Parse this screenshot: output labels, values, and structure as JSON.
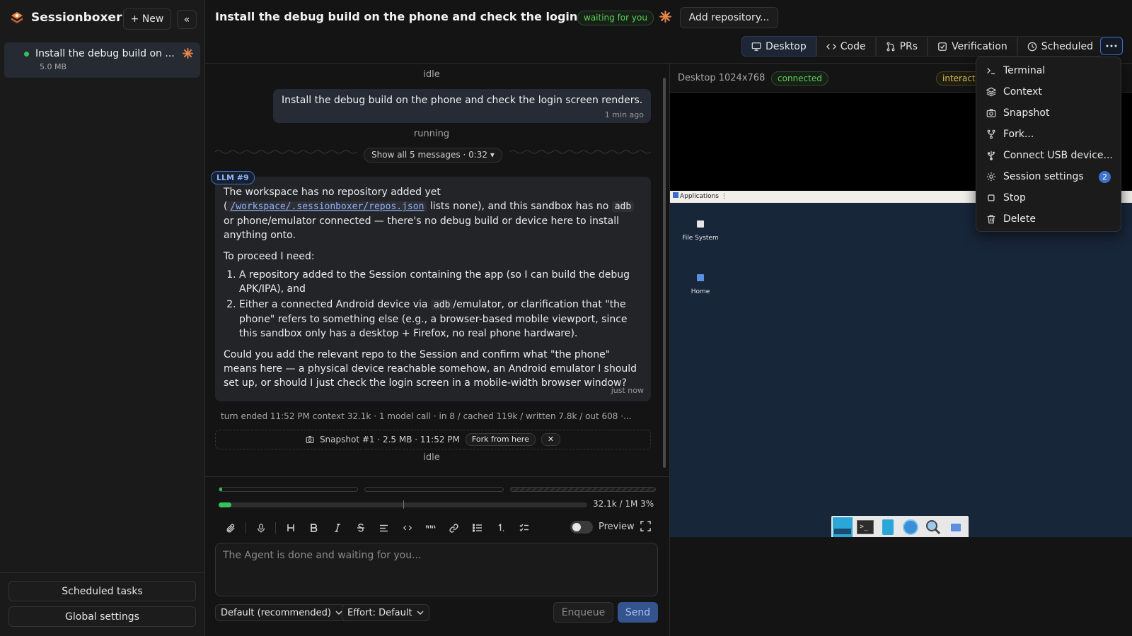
{
  "app": {
    "name": "Sessionboxer"
  },
  "sidebar": {
    "new_label": "+ New",
    "collapse_label": "«",
    "session": {
      "title": "Install the debug build on ...",
      "size": "5.0 MB"
    },
    "scheduled_tasks_label": "Scheduled tasks",
    "global_settings_label": "Global settings"
  },
  "header": {
    "title": "Install the debug build on the phone and check the login ...",
    "status": "waiting for you",
    "add_repo_label": "Add repository..."
  },
  "tabs": [
    {
      "label": "Desktop",
      "icon": "monitor-icon",
      "active": true
    },
    {
      "label": "Code",
      "icon": "code-icon"
    },
    {
      "label": "PRs",
      "icon": "pull-request-icon"
    },
    {
      "label": "Verification",
      "icon": "check-square-icon"
    },
    {
      "label": "Scheduled",
      "icon": "clock-icon"
    }
  ],
  "menu": {
    "items": [
      {
        "label": "Terminal",
        "icon": "terminal-icon"
      },
      {
        "label": "Context",
        "icon": "layers-icon"
      },
      {
        "label": "Snapshot",
        "icon": "camera-icon"
      },
      {
        "label": "Fork...",
        "icon": "fork-icon"
      },
      {
        "label": "Connect USB device...",
        "icon": "usb-icon"
      },
      {
        "label": "Session settings",
        "icon": "gear-icon",
        "badge": "2"
      },
      {
        "label": "Stop",
        "icon": "stop-icon"
      },
      {
        "label": "Delete",
        "icon": "trash-icon"
      }
    ]
  },
  "chat": {
    "status_top": "idle",
    "user_message": "Install the debug build on the phone and check the login screen renders.",
    "user_time": "1 min ago",
    "status_running": "running",
    "show_all": "Show all 5 messages · 0:32 ▾",
    "llm_tag": "LLM #9",
    "agent": {
      "p1_a": "The workspace has no repository added yet (",
      "p1_path": "/workspace/.sessionboxer/repos.json",
      "p1_b": " lists none), and this sandbox has no ",
      "p1_code": "adb",
      "p1_c": " or phone/emulator connected — there's no debug build or device here to install anything onto.",
      "p2": "To proceed I need:",
      "li1": "A repository added to the Session containing the app (so I can build the debug APK/IPA), and",
      "li2_a": "Either a connected Android device via ",
      "li2_code": "adb",
      "li2_b": "/emulator, or clarification that \"the phone\" refers to something else (e.g., a browser-based mobile viewport, since this sandbox only has a desktop + Firefox, no real phone hardware).",
      "p3": "Could you add the relevant repo to the Session and confirm what \"the phone\" means here — a physical device reachable somehow, an Android emulator I should set up, or should I just check the login screen in a mobile-width browser window?",
      "time": "just now"
    },
    "turn_meta": "turn ended 11:52 PM  context 32.1k · 1 model call · in 8 / cached 119k / written 7.8k / out 608 ·...",
    "snapshot": {
      "label": "Snapshot #1 · 2.5 MB · 11:52 PM",
      "fork_label": "Fork from here",
      "close_label": "✕"
    },
    "status_bottom": "idle"
  },
  "composer": {
    "context_text": "32.1k / 1M 3%",
    "context_fraction": 0.03,
    "preview_label": "Preview",
    "placeholder": "The Agent is done and waiting for you...",
    "model_select": "Default (recommended)",
    "effort_select": "Effort: Default",
    "enqueue_label": "Enqueue",
    "send_label": "Send"
  },
  "desktop": {
    "label": "Desktop 1024x768",
    "connected": "connected",
    "interact": "interact",
    "apps_bar": "Applications ⋮",
    "icons": [
      {
        "label": "File System"
      },
      {
        "label": "Home"
      }
    ]
  },
  "colors": {
    "accent": "#3f72c9",
    "success": "#35c25a",
    "spark": "#e8874a"
  }
}
